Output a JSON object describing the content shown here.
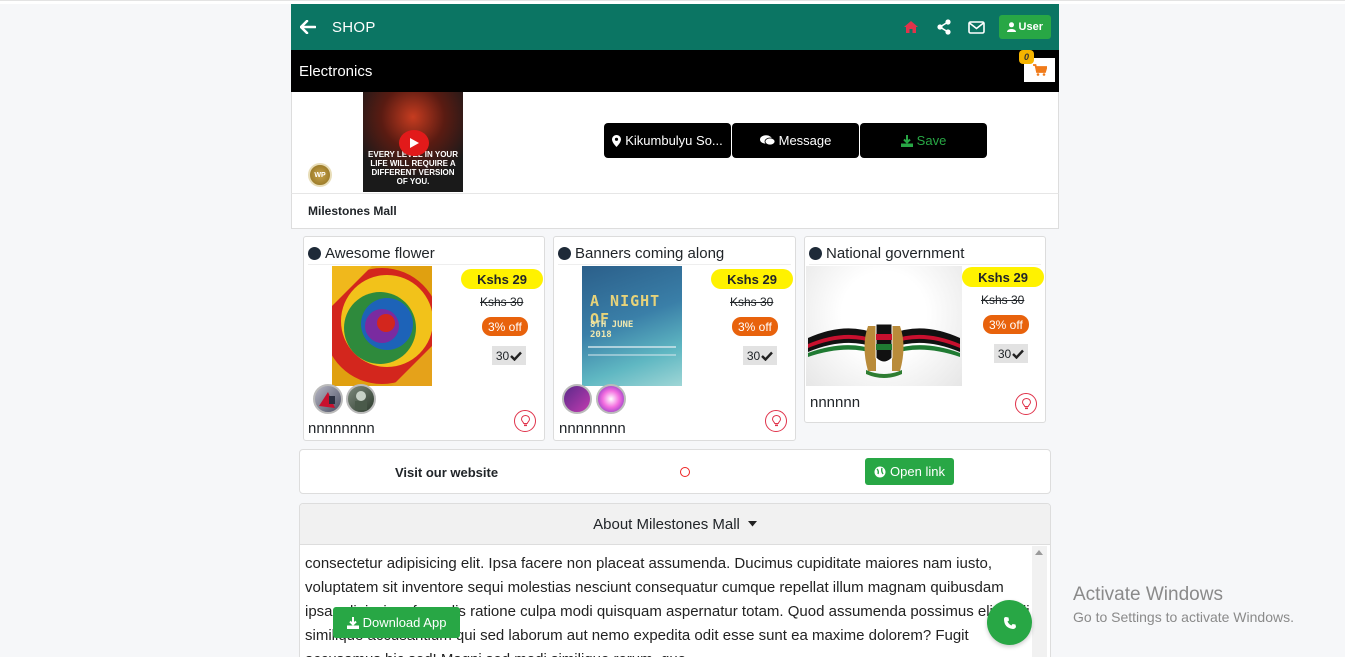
{
  "header": {
    "title": "SHOP",
    "user_label": "User"
  },
  "category": {
    "title": "Electronics",
    "cart_count": "0"
  },
  "profile": {
    "logo_text": "WP",
    "video_text": "EVERY LEVEL IN YOUR LIFE WILL REQUIRE A DIFFERENT VERSION OF YOU.",
    "location_label": "Kikumbulyu So...",
    "message_label": "Message",
    "save_label": "Save",
    "mall_name": "Milestones Mall"
  },
  "products": [
    {
      "title": "Awesome flower",
      "price": "Kshs 29",
      "old_price": "Kshs 30",
      "discount": "3% off",
      "stock": "30",
      "description": "nnnnnnnn"
    },
    {
      "title": "Banners coming along",
      "price": "Kshs 29",
      "old_price": "Kshs 30",
      "discount": "3% off",
      "stock": "30",
      "description": "nnnnnnnn",
      "poster_title": "A NIGHT OF",
      "poster_date": "8TH JUNE 2018"
    },
    {
      "title": "National government",
      "price": "Kshs 29",
      "old_price": "Kshs 30",
      "discount": "3% off",
      "stock": "30",
      "description": "nnnnnn"
    }
  ],
  "website": {
    "label": "Visit our website",
    "button": "Open link"
  },
  "about": {
    "title": "About Milestones Mall",
    "text": "consectetur adipisicing elit. Ipsa facere non placeat assumenda. Ducimus cupiditate maiores nam iusto, voluptatem sit inventore sequi molestias nesciunt consequatur cumque repellat illum magnam quibusdam ipsa adipisci perferendis ratione culpa modi quisquam aspernatur totam. Quod assumenda possimus eligendi similique accusantium qui sed laborum aut nemo expedita odit esse sunt ea maxime dolorem? Fugit accusamus hic sed! Magni sed modi similique rerum, quo"
  },
  "download_label": "Download App",
  "watermark": {
    "line1": "Activate Windows",
    "line2": "Go to Settings to activate Windows."
  },
  "colors": {
    "header": "#0b7563",
    "accent_green": "#28a745",
    "price_yellow": "#fff200",
    "discount_orange": "#e8620c"
  }
}
